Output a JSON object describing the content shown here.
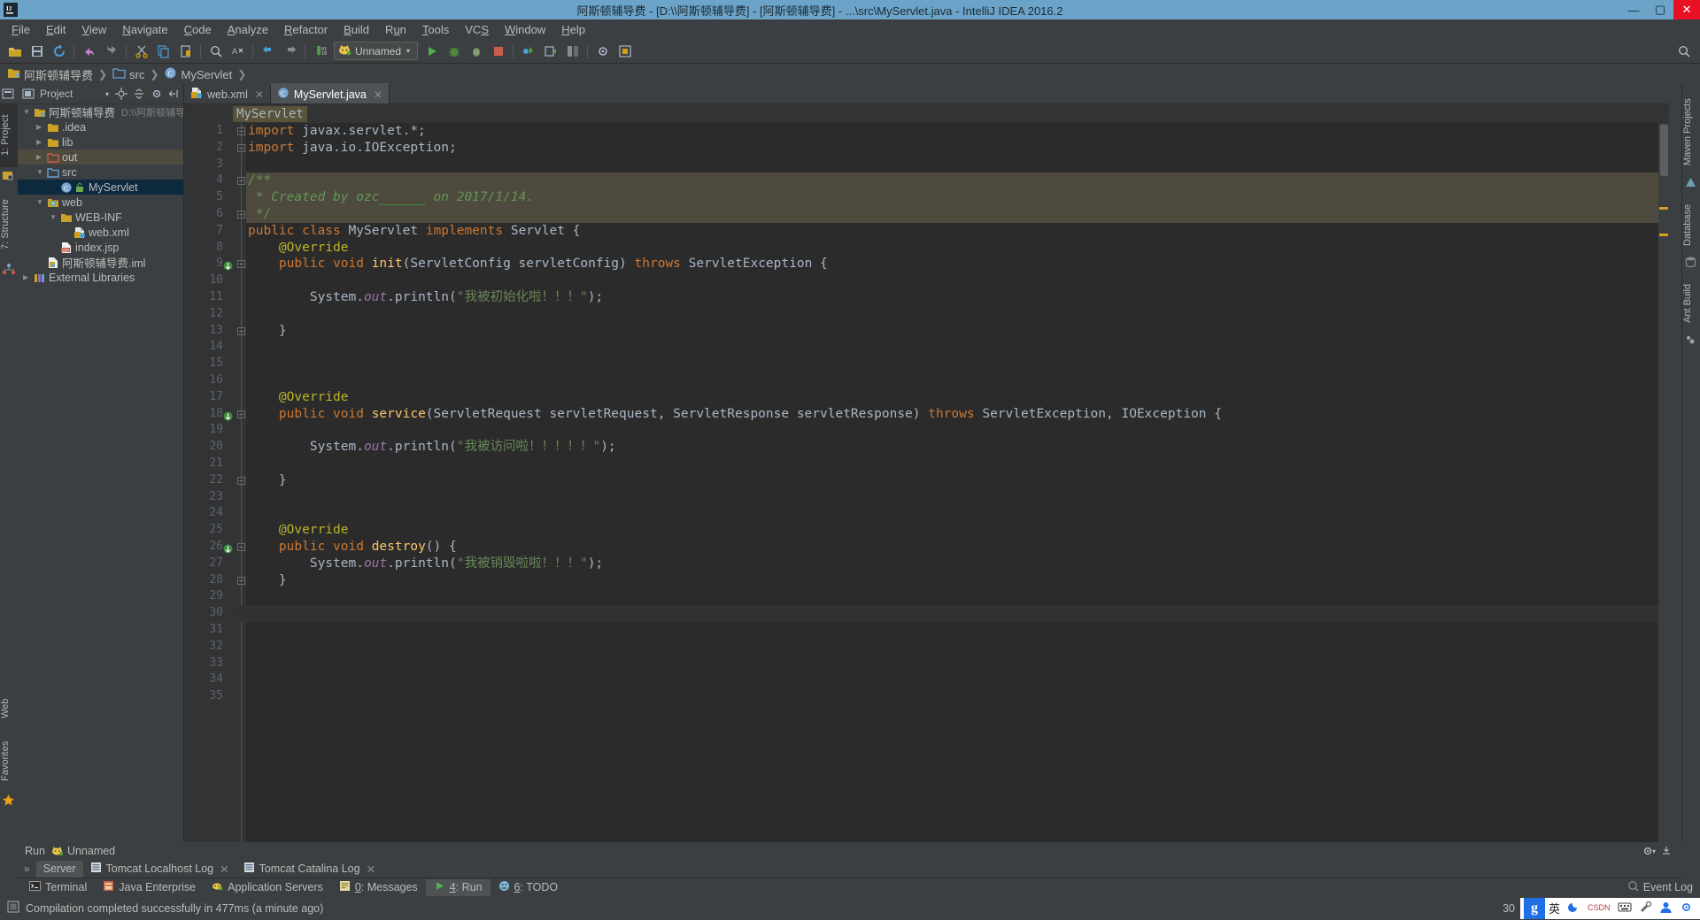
{
  "window": {
    "title": "阿斯顿辅导费 - [D:\\\\阿斯顿辅导费] - [阿斯顿辅导费] - ...\\src\\MyServlet.java - IntelliJ IDEA 2016.2",
    "minimize": "—",
    "maximize": "▢",
    "close": "✕",
    "logo_name": "intellij-idea-logo"
  },
  "menubar": {
    "items": [
      {
        "label": "File",
        "mnemonic": "F"
      },
      {
        "label": "Edit",
        "mnemonic": "E"
      },
      {
        "label": "View",
        "mnemonic": "V"
      },
      {
        "label": "Navigate",
        "mnemonic": "N"
      },
      {
        "label": "Code",
        "mnemonic": "C"
      },
      {
        "label": "Analyze",
        "mnemonic": "A"
      },
      {
        "label": "Refactor",
        "mnemonic": "R"
      },
      {
        "label": "Build",
        "mnemonic": "B"
      },
      {
        "label": "Run",
        "mnemonic": "u"
      },
      {
        "label": "Tools",
        "mnemonic": "T"
      },
      {
        "label": "VCS",
        "mnemonic": "S"
      },
      {
        "label": "Window",
        "mnemonic": "W"
      },
      {
        "label": "Help",
        "mnemonic": "H"
      }
    ]
  },
  "toolbar": {
    "run_config": {
      "label": "Unnamed",
      "icon": "tomcat-cat-icon",
      "caret": "▾"
    },
    "icons": [
      "open-folder-icon",
      "save-all-icon",
      "sync-refresh-icon",
      "undo-icon",
      "redo-icon",
      "cut-icon",
      "copy-icon",
      "paste-icon",
      "find-icon",
      "replace-icon",
      "back-icon",
      "forward-icon",
      "compile-icon"
    ],
    "right_icons": [
      "search-everywhere-icon"
    ]
  },
  "breadcrumb": {
    "items": [
      {
        "label": "阿斯顿辅导费",
        "icon": "module-folder-icon"
      },
      {
        "label": "src",
        "icon": "source-folder-icon"
      },
      {
        "label": "MyServlet",
        "icon": "java-class-icon"
      }
    ],
    "separator": "❯"
  },
  "left_strip": {
    "tabs": [
      {
        "label": "1: Project",
        "active": true
      },
      {
        "label": "7: Structure",
        "active": false
      },
      {
        "label": "Web",
        "active": false
      },
      {
        "label": "Favorites",
        "active": false
      }
    ]
  },
  "right_strip": {
    "tabs": [
      {
        "label": "Maven Projects"
      },
      {
        "label": "Database"
      },
      {
        "label": "Ant Build"
      }
    ]
  },
  "project_panel": {
    "header": {
      "title": "Project",
      "caret": "▾",
      "icons": [
        "locate-icon",
        "collapse-all-icon",
        "settings-gear-icon",
        "hide-icon"
      ]
    },
    "tree": [
      {
        "label": "阿斯顿辅导费",
        "sub": "D:\\\\阿斯顿辅导费",
        "depth": 0,
        "twisty": "▼",
        "icon": "module-folder-icon",
        "state": "normal"
      },
      {
        "label": ".idea",
        "sub": "",
        "depth": 1,
        "twisty": "▶",
        "icon": "folder-icon",
        "state": "normal"
      },
      {
        "label": "lib",
        "sub": "",
        "depth": 1,
        "twisty": "▶",
        "icon": "folder-icon",
        "state": "normal"
      },
      {
        "label": "out",
        "sub": "",
        "depth": 1,
        "twisty": "▶",
        "icon": "excluded-folder-icon",
        "state": "highlight"
      },
      {
        "label": "src",
        "sub": "",
        "depth": 1,
        "twisty": "▼",
        "icon": "source-folder-icon",
        "state": "normal"
      },
      {
        "label": "MyServlet",
        "sub": "",
        "depth": 2,
        "twisty": "",
        "icon": "java-class-icon",
        "state": "selected"
      },
      {
        "label": "web",
        "sub": "",
        "depth": 1,
        "twisty": "▼",
        "icon": "web-folder-icon",
        "state": "normal"
      },
      {
        "label": "WEB-INF",
        "sub": "",
        "depth": 2,
        "twisty": "▼",
        "icon": "folder-icon",
        "state": "normal"
      },
      {
        "label": "web.xml",
        "sub": "",
        "depth": 3,
        "twisty": "",
        "icon": "xml-file-icon",
        "state": "normal"
      },
      {
        "label": "index.jsp",
        "sub": "",
        "depth": 2,
        "twisty": "",
        "icon": "jsp-file-icon",
        "state": "normal"
      },
      {
        "label": "阿斯顿辅导费.iml",
        "sub": "",
        "depth": 1,
        "twisty": "",
        "icon": "iml-file-icon",
        "state": "normal"
      },
      {
        "label": "External Libraries",
        "sub": "",
        "depth": 0,
        "twisty": "▶",
        "icon": "libraries-icon",
        "state": "normal"
      }
    ]
  },
  "editor": {
    "tabs": [
      {
        "label": "web.xml",
        "icon": "xml-file-icon",
        "active": false,
        "close": "✕"
      },
      {
        "label": "MyServlet.java",
        "icon": "java-class-icon",
        "active": true,
        "close": "✕"
      }
    ],
    "breadcrumb_chip": "MyServlet",
    "lines": [
      {
        "n": "1",
        "tokens": [
          {
            "t": "import ",
            "c": "kw"
          },
          {
            "t": "javax.servlet.*;",
            "c": "pln"
          }
        ],
        "fold": "top",
        "gutter": "",
        "hl": false,
        "caret": false
      },
      {
        "n": "2",
        "tokens": [
          {
            "t": "import ",
            "c": "kw"
          },
          {
            "t": "java.io.IOException;",
            "c": "pln"
          }
        ],
        "fold": "bottom",
        "gutter": "",
        "hl": false,
        "caret": false
      },
      {
        "n": "3",
        "tokens": [],
        "fold": "",
        "gutter": "",
        "hl": false,
        "caret": false
      },
      {
        "n": "4",
        "tokens": [
          {
            "t": "/**",
            "c": "cmt"
          }
        ],
        "fold": "top",
        "gutter": "",
        "hl": true,
        "caret": false
      },
      {
        "n": "5",
        "tokens": [
          {
            "t": " * Created by ozc",
            "c": "cmt"
          },
          {
            "t": "      ",
            "c": "und"
          },
          {
            "t": " on 2017/1/14.",
            "c": "cmt"
          }
        ],
        "fold": "",
        "gutter": "",
        "hl": true,
        "caret": false
      },
      {
        "n": "6",
        "tokens": [
          {
            "t": " */",
            "c": "cmt"
          }
        ],
        "fold": "bottom",
        "gutter": "",
        "hl": true,
        "caret": false
      },
      {
        "n": "7",
        "tokens": [
          {
            "t": "public class ",
            "c": "kw"
          },
          {
            "t": "MyServlet ",
            "c": "cls"
          },
          {
            "t": "implements ",
            "c": "kw"
          },
          {
            "t": "Servlet {",
            "c": "cls"
          }
        ],
        "fold": "",
        "gutter": "",
        "hl": false,
        "caret": false
      },
      {
        "n": "8",
        "tokens": [
          {
            "t": "    @Override",
            "c": "ann"
          }
        ],
        "fold": "",
        "gutter": "",
        "hl": false,
        "caret": false
      },
      {
        "n": "9",
        "tokens": [
          {
            "t": "    public void ",
            "c": "kw"
          },
          {
            "t": "init",
            "c": "mth"
          },
          {
            "t": "(ServletConfig servletConfig) ",
            "c": "cls"
          },
          {
            "t": "throws ",
            "c": "kw"
          },
          {
            "t": "ServletException {",
            "c": "cls"
          }
        ],
        "fold": "top",
        "gutter": "impl-override-icon",
        "hl": false,
        "caret": false
      },
      {
        "n": "10",
        "tokens": [],
        "fold": "",
        "gutter": "",
        "hl": false,
        "caret": false
      },
      {
        "n": "11",
        "tokens": [
          {
            "t": "        System.",
            "c": "cls"
          },
          {
            "t": "out",
            "c": "fld"
          },
          {
            "t": ".println(",
            "c": "cls"
          },
          {
            "t": "\"我被初始化啦！！！\"",
            "c": "str"
          },
          {
            "t": ");",
            "c": "cls"
          }
        ],
        "fold": "",
        "gutter": "",
        "hl": false,
        "caret": false
      },
      {
        "n": "12",
        "tokens": [],
        "fold": "",
        "gutter": "",
        "hl": false,
        "caret": false
      },
      {
        "n": "13",
        "tokens": [
          {
            "t": "    }",
            "c": "cls"
          }
        ],
        "fold": "bottom",
        "gutter": "",
        "hl": false,
        "caret": false
      },
      {
        "n": "14",
        "tokens": [],
        "fold": "",
        "gutter": "",
        "hl": false,
        "caret": false
      },
      {
        "n": "15",
        "tokens": [],
        "fold": "",
        "gutter": "",
        "hl": false,
        "caret": false
      },
      {
        "n": "16",
        "tokens": [],
        "fold": "",
        "gutter": "",
        "hl": false,
        "caret": false
      },
      {
        "n": "17",
        "tokens": [
          {
            "t": "    @Override",
            "c": "ann"
          }
        ],
        "fold": "",
        "gutter": "",
        "hl": false,
        "caret": false
      },
      {
        "n": "18",
        "tokens": [
          {
            "t": "    public void ",
            "c": "kw"
          },
          {
            "t": "service",
            "c": "mth"
          },
          {
            "t": "(ServletRequest servletRequest, ServletResponse servletResponse) ",
            "c": "cls"
          },
          {
            "t": "throws ",
            "c": "kw"
          },
          {
            "t": "ServletException, IOException {",
            "c": "cls"
          }
        ],
        "fold": "top",
        "gutter": "impl-override-icon",
        "hl": false,
        "caret": false
      },
      {
        "n": "19",
        "tokens": [],
        "fold": "",
        "gutter": "",
        "hl": false,
        "caret": false
      },
      {
        "n": "20",
        "tokens": [
          {
            "t": "        System.",
            "c": "cls"
          },
          {
            "t": "out",
            "c": "fld"
          },
          {
            "t": ".println(",
            "c": "cls"
          },
          {
            "t": "\"我被访问啦！！！！！\"",
            "c": "str"
          },
          {
            "t": ");",
            "c": "cls"
          }
        ],
        "fold": "",
        "gutter": "",
        "hl": false,
        "caret": false
      },
      {
        "n": "21",
        "tokens": [],
        "fold": "",
        "gutter": "",
        "hl": false,
        "caret": false
      },
      {
        "n": "22",
        "tokens": [
          {
            "t": "    }",
            "c": "cls"
          }
        ],
        "fold": "bottom",
        "gutter": "",
        "hl": false,
        "caret": false
      },
      {
        "n": "23",
        "tokens": [],
        "fold": "",
        "gutter": "",
        "hl": false,
        "caret": false
      },
      {
        "n": "24",
        "tokens": [],
        "fold": "",
        "gutter": "",
        "hl": false,
        "caret": false
      },
      {
        "n": "25",
        "tokens": [
          {
            "t": "    @Override",
            "c": "ann"
          }
        ],
        "fold": "",
        "gutter": "",
        "hl": false,
        "caret": false
      },
      {
        "n": "26",
        "tokens": [
          {
            "t": "    public void ",
            "c": "kw"
          },
          {
            "t": "destroy",
            "c": "mth"
          },
          {
            "t": "() {",
            "c": "cls"
          }
        ],
        "fold": "top",
        "gutter": "impl-override-icon",
        "hl": false,
        "caret": false
      },
      {
        "n": "27",
        "tokens": [
          {
            "t": "        System.",
            "c": "cls"
          },
          {
            "t": "out",
            "c": "fld"
          },
          {
            "t": ".println(",
            "c": "cls"
          },
          {
            "t": "\"我被销毁啦啦！！！\"",
            "c": "str"
          },
          {
            "t": ");",
            "c": "cls"
          }
        ],
        "fold": "",
        "gutter": "",
        "hl": false,
        "caret": false
      },
      {
        "n": "28",
        "tokens": [
          {
            "t": "    }",
            "c": "cls"
          }
        ],
        "fold": "bottom",
        "gutter": "",
        "hl": false,
        "caret": false
      },
      {
        "n": "29",
        "tokens": [],
        "fold": "",
        "gutter": "",
        "hl": false,
        "caret": false
      },
      {
        "n": "30",
        "tokens": [],
        "fold": "",
        "gutter": "",
        "hl": false,
        "caret": true
      },
      {
        "n": "31",
        "tokens": [],
        "fold": "",
        "gutter": "",
        "hl": false,
        "caret": false
      },
      {
        "n": "32",
        "tokens": [],
        "fold": "",
        "gutter": "",
        "hl": false,
        "caret": false
      },
      {
        "n": "33",
        "tokens": [],
        "fold": "",
        "gutter": "",
        "hl": false,
        "caret": false
      },
      {
        "n": "34",
        "tokens": [],
        "fold": "",
        "gutter": "",
        "hl": false,
        "caret": false
      },
      {
        "n": "35",
        "tokens": [],
        "fold": "",
        "gutter": "",
        "hl": false,
        "caret": false
      }
    ]
  },
  "run_panel": {
    "title": "Run",
    "config_name": "Unnamed",
    "config_icon": "tomcat-cat-icon",
    "settings_icon": "settings-gear-icon",
    "hide_icon": "hide-panel-icon",
    "chevron": "»",
    "subtabs": [
      {
        "label": "Server",
        "icon": "",
        "active": true,
        "close": ""
      },
      {
        "label": "Tomcat Localhost Log",
        "icon": "log-file-icon",
        "active": false,
        "close": "✕"
      },
      {
        "label": "Tomcat Catalina Log",
        "icon": "log-file-icon",
        "active": false,
        "close": "✕"
      }
    ]
  },
  "tool_windows": {
    "buttons": [
      {
        "label": "Terminal",
        "icon": "terminal-icon",
        "active": false,
        "mnemonic": ""
      },
      {
        "label": "Java Enterprise",
        "icon": "java-enterprise-icon",
        "active": false,
        "mnemonic": ""
      },
      {
        "label": "Application Servers",
        "icon": "app-servers-icon",
        "active": false,
        "mnemonic": ""
      },
      {
        "label": "0: Messages",
        "icon": "messages-icon",
        "active": false,
        "mnemonic": "0"
      },
      {
        "label": "4: Run",
        "icon": "run-play-icon",
        "active": true,
        "mnemonic": "4"
      },
      {
        "label": "6: TODO",
        "icon": "todo-icon",
        "active": false,
        "mnemonic": "6"
      }
    ],
    "event_log": {
      "label": "Event Log",
      "icon": "event-log-icon"
    }
  },
  "statusbar": {
    "icon": "status-toggle-icon",
    "message": "Compilation completed successfully in 477ms (a minute ago)",
    "right_number": "30",
    "ime": {
      "logo": "g",
      "mode": "英",
      "items": [
        "crescent-icon",
        "csdn-icon",
        "keyboard-icon",
        "tools-icon",
        "user-icon",
        "settings-gear-icon"
      ]
    }
  },
  "colors": {
    "titlebar": "#6ba4c8",
    "chrome": "#3c3f41",
    "editor_bg": "#2b2b2b",
    "gutter_bg": "#313335",
    "selection": "#0d293e",
    "comment_block_hl": "#4e4a3e",
    "close_red": "#e81123",
    "keyword": "#cc7832",
    "string": "#6a8759",
    "comment": "#629755",
    "annotation": "#bbb529",
    "method": "#ffc66d",
    "field": "#9876aa",
    "plain": "#a9b7c6"
  }
}
